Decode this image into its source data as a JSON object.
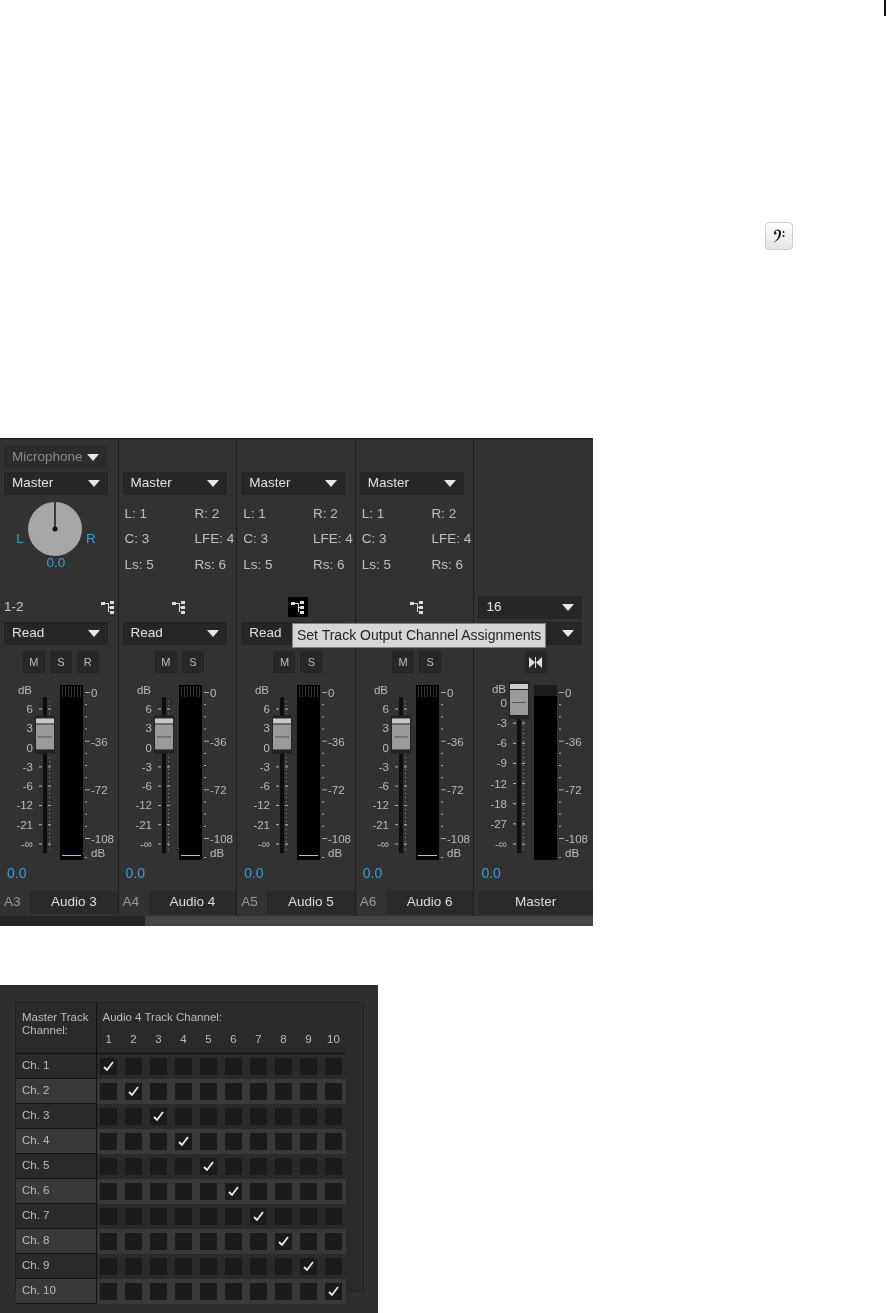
{
  "mixer": {
    "tooltip": "Set Track Output Channel Assignments",
    "tracks": [
      {
        "kind": "audio",
        "input": "Microphone",
        "output": "Master",
        "pan": {
          "left": "L",
          "right": "R",
          "value": "0.0"
        },
        "channel_set": "1-2",
        "routing_selected": false,
        "automation": "Read",
        "buttons": [
          "M",
          "S",
          "R"
        ],
        "fader_unit": "dB",
        "fader_scale": [
          "6",
          "3",
          "0",
          "-3",
          "-6",
          "-12",
          "-21",
          "-∞"
        ],
        "level": 0.76,
        "meter_scale": [
          "0",
          "-36",
          "-72",
          "-108"
        ],
        "meter_unit": "dB",
        "volume": "0.0",
        "number": "A3",
        "name": "Audio 3"
      },
      {
        "kind": "audio",
        "output": "Master",
        "assignments": [
          {
            "left": "L: 1",
            "right": "R: 2"
          },
          {
            "left": "C: 3",
            "right": "LFE: 4"
          },
          {
            "left": "Ls: 5",
            "right": "Rs: 6"
          }
        ],
        "routing_selected": false,
        "automation": "Read",
        "buttons": [
          "M",
          "S"
        ],
        "fader_unit": "dB",
        "fader_scale": [
          "6",
          "3",
          "0",
          "-3",
          "-6",
          "-12",
          "-21",
          "-∞"
        ],
        "level": 0.76,
        "meter_scale": [
          "0",
          "-36",
          "-72",
          "-108"
        ],
        "meter_unit": "dB",
        "volume": "0.0",
        "number": "A4",
        "name": "Audio 4"
      },
      {
        "kind": "audio",
        "output": "Master",
        "assignments": [
          {
            "left": "L: 1",
            "right": "R: 2"
          },
          {
            "left": "C: 3",
            "right": "LFE: 4"
          },
          {
            "left": "Ls: 5",
            "right": "Rs: 6"
          }
        ],
        "routing_selected": true,
        "automation": "Read",
        "buttons": [
          "M",
          "S"
        ],
        "fader_unit": "dB",
        "fader_scale": [
          "6",
          "3",
          "0",
          "-3",
          "-6",
          "-12",
          "-21",
          "-∞"
        ],
        "level": 0.76,
        "meter_scale": [
          "0",
          "-36",
          "-72",
          "-108"
        ],
        "meter_unit": "dB",
        "volume": "0.0",
        "number": "A5",
        "name": "Audio 5"
      },
      {
        "kind": "audio",
        "output": "Master",
        "assignments": [
          {
            "left": "L: 1",
            "right": "R: 2"
          },
          {
            "left": "C: 3",
            "right": "LFE: 4"
          },
          {
            "left": "Ls: 5",
            "right": "Rs: 6"
          }
        ],
        "routing_selected": false,
        "buttons": [
          "M",
          "S"
        ],
        "fader_unit": "dB",
        "fader_scale": [
          "6",
          "3",
          "0",
          "-3",
          "-6",
          "-12",
          "-21",
          "-∞"
        ],
        "level": 0.76,
        "meter_scale": [
          "0",
          "-36",
          "-72",
          "-108"
        ],
        "meter_unit": "dB",
        "volume": "0.0",
        "number": "A6",
        "name": "Audio 6"
      },
      {
        "kind": "master",
        "channels": "16",
        "fader_unit": "dB",
        "fader_scale": [
          "0",
          "-3",
          "-6",
          "-9",
          "-12",
          "-18",
          "-27",
          "-∞"
        ],
        "level": 0.99,
        "meter_scale": [
          "0",
          "-36",
          "-72",
          "-108"
        ],
        "meter_unit": "dB",
        "volume": "0.0",
        "name": "Master"
      }
    ]
  },
  "matrix": {
    "row_header": "Master Track Channel:",
    "column_header": "Audio 4 Track Channel:",
    "columns": [
      "1",
      "2",
      "3",
      "4",
      "5",
      "6",
      "7",
      "8",
      "9",
      "10"
    ],
    "rows": [
      {
        "label": "Ch. 1",
        "checked": [
          true,
          false,
          false,
          false,
          false,
          false,
          false,
          false,
          false,
          false
        ]
      },
      {
        "label": "Ch. 2",
        "checked": [
          false,
          true,
          false,
          false,
          false,
          false,
          false,
          false,
          false,
          false
        ]
      },
      {
        "label": "Ch. 3",
        "checked": [
          false,
          false,
          true,
          false,
          false,
          false,
          false,
          false,
          false,
          false
        ]
      },
      {
        "label": "Ch. 4",
        "checked": [
          false,
          false,
          false,
          true,
          false,
          false,
          false,
          false,
          false,
          false
        ]
      },
      {
        "label": "Ch. 5",
        "checked": [
          false,
          false,
          false,
          false,
          true,
          false,
          false,
          false,
          false,
          false
        ]
      },
      {
        "label": "Ch. 6",
        "checked": [
          false,
          false,
          false,
          false,
          false,
          true,
          false,
          false,
          false,
          false
        ]
      },
      {
        "label": "Ch. 7",
        "checked": [
          false,
          false,
          false,
          false,
          false,
          false,
          true,
          false,
          false,
          false
        ]
      },
      {
        "label": "Ch. 8",
        "checked": [
          false,
          false,
          false,
          false,
          false,
          false,
          false,
          true,
          false,
          false
        ]
      },
      {
        "label": "Ch. 9",
        "checked": [
          false,
          false,
          false,
          false,
          false,
          false,
          false,
          false,
          true,
          false
        ]
      },
      {
        "label": "Ch. 10",
        "checked": [
          false,
          false,
          false,
          false,
          false,
          false,
          false,
          false,
          false,
          true
        ]
      }
    ]
  }
}
